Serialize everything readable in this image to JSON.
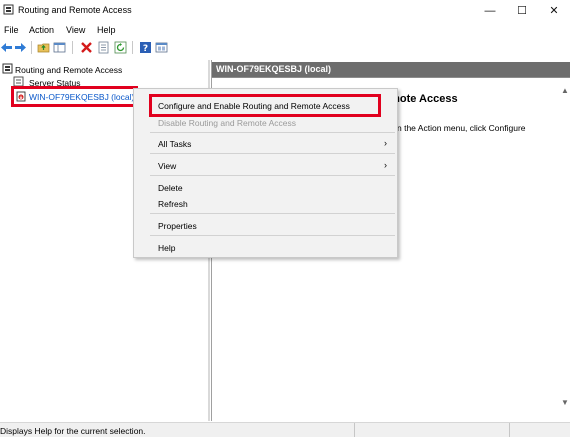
{
  "window": {
    "title": "Routing and Remote Access",
    "controls": {
      "minimize": "—",
      "maximize": "☐",
      "close": "✕"
    }
  },
  "menubar": {
    "items": [
      "File",
      "Action",
      "View",
      "Help"
    ]
  },
  "toolbar": {
    "icons": [
      "back-icon",
      "forward-icon",
      "up-folder-icon",
      "show-hide-tree-icon",
      "delete-icon",
      "properties-icon",
      "refresh-icon",
      "help-icon",
      "console-icon"
    ]
  },
  "tree": {
    "root": "Routing and Remote Access",
    "server_status": "Server Status",
    "server": "WIN-OF79EKQESBJ (local)"
  },
  "right_pane": {
    "header": "WIN-OF79EKQESBJ (local)",
    "heading_partial": "emote Access",
    "body_partial": "n the Action menu, click Configure"
  },
  "context_menu": {
    "items": [
      {
        "label": "Configure and Enable Routing and Remote Access",
        "enabled": true,
        "highlighted": true
      },
      {
        "label": "Disable Routing and Remote Access",
        "enabled": false
      },
      {
        "label": "All Tasks",
        "submenu": true
      },
      {
        "label": "View",
        "submenu": true
      },
      {
        "label": "Delete"
      },
      {
        "label": "Refresh"
      },
      {
        "label": "Properties"
      },
      {
        "label": "Help"
      }
    ]
  },
  "statusbar": {
    "text": "Displays Help for the current selection."
  },
  "colors": {
    "annotation_red": "#e1001e",
    "header_gray": "#6d6d6d",
    "tree_selected": "#0a58ca"
  }
}
